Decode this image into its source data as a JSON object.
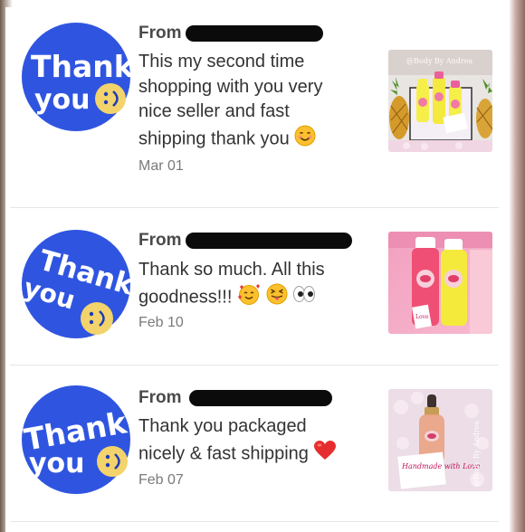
{
  "reviews": [
    {
      "from_label": "From",
      "avatar_text": [
        "Thank",
        "you"
      ],
      "message_lines": [
        "This my second time",
        "shopping with you very",
        "nice seller and fast",
        "shipping thank you"
      ],
      "emojis": [
        "smiling-face"
      ],
      "date": "Mar 01",
      "photo_watermark": "@Body By Andrea"
    },
    {
      "from_label": "From",
      "avatar_text": [
        "Thank",
        "you"
      ],
      "message_lines": [
        "Thank so much. All this",
        "goodness!!!"
      ],
      "emojis": [
        "smiling-face-with-hearts",
        "squinting-tongue-face",
        "eyes"
      ],
      "date": "Feb 10",
      "photo_watermark": "Love"
    },
    {
      "from_label": "From",
      "avatar_text": [
        "Thank",
        "you"
      ],
      "message_lines": [
        "Thank you packaged",
        "nicely & fast shipping"
      ],
      "emojis": [
        "red-heart"
      ],
      "date": "Feb 07",
      "photo_watermark": "@Body By Andrea",
      "photo_caption": "Handmade with Love"
    }
  ],
  "colors": {
    "avatar_blue": "#2f55e0",
    "smiley_yellow": "#f3d36b",
    "text": "#333333",
    "muted": "#7a7a7a",
    "redaction": "#0b0b0b"
  }
}
